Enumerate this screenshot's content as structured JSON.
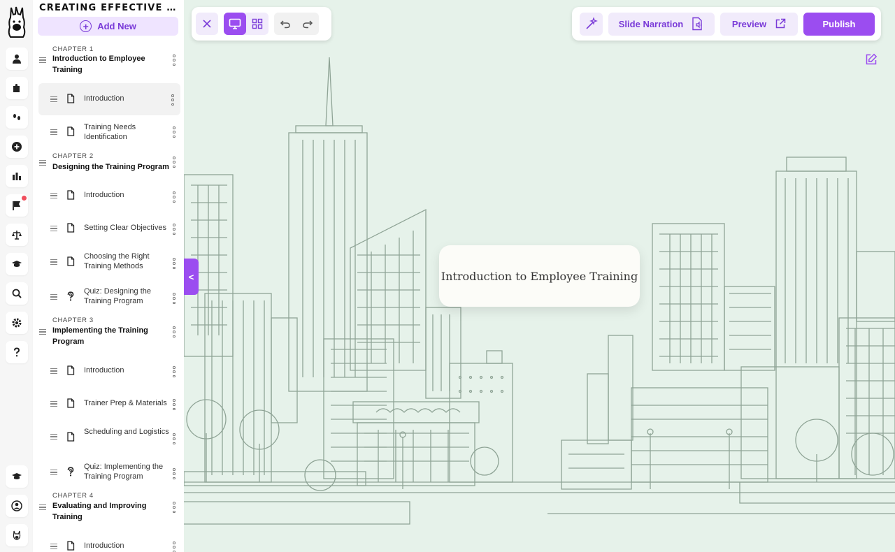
{
  "course": {
    "title": "CREATING EFFECTIVE TRAINING PROGRAMS",
    "add_new_label": "Add New"
  },
  "rail": {
    "icons": [
      "user-icon",
      "puzzle-icon",
      "footprints-icon",
      "plus-circle-icon",
      "bar-chart-icon",
      "flag-icon",
      "scales-icon",
      "graduation-cap-icon",
      "search-icon",
      "gear-icon",
      "question-icon"
    ],
    "bottom_icons": [
      "graduation-cap-icon",
      "account-circle-icon",
      "avatar-icon"
    ]
  },
  "outline": {
    "chapters": [
      {
        "label": "CHAPTER 1",
        "title": "Introduction to Employee Training",
        "lessons": [
          {
            "text": "Introduction",
            "icon": "page-icon"
          },
          {
            "text": "Training Needs Identification",
            "icon": "page-icon"
          }
        ]
      },
      {
        "label": "CHAPTER 2",
        "title": "Designing the Training Program",
        "lessons": [
          {
            "text": "Introduction",
            "icon": "page-icon"
          },
          {
            "text": "Setting Clear Objectives",
            "icon": "page-icon"
          },
          {
            "text": "Choosing the Right Training Methods",
            "icon": "page-icon"
          },
          {
            "text": "Quiz: Designing the Training Program",
            "icon": "quiz-icon"
          }
        ]
      },
      {
        "label": "CHAPTER 3",
        "title": "Implementing the Training Program",
        "lessons": [
          {
            "text": "Introduction",
            "icon": "page-icon"
          },
          {
            "text": "Trainer Prep & Materials",
            "icon": "page-icon"
          },
          {
            "text": "Scheduling and Logistics",
            "icon": "page-icon"
          },
          {
            "text": "Quiz: Implementing the Training Program",
            "icon": "quiz-icon"
          }
        ]
      },
      {
        "label": "CHAPTER 4",
        "title": "Evaluating and Improving Training",
        "lessons": [
          {
            "text": "Introduction",
            "icon": "page-icon"
          }
        ]
      }
    ]
  },
  "toolbar": {
    "narration_label": "Slide Narration",
    "preview_label": "Preview",
    "publish_label": "Publish"
  },
  "slide": {
    "title": "Introduction to Employee Training"
  },
  "colors": {
    "accent": "#9b4df0",
    "accent_light": "#f1ebfb",
    "canvas_bg": "#e6f2ea",
    "line_art": "#8fa496"
  }
}
